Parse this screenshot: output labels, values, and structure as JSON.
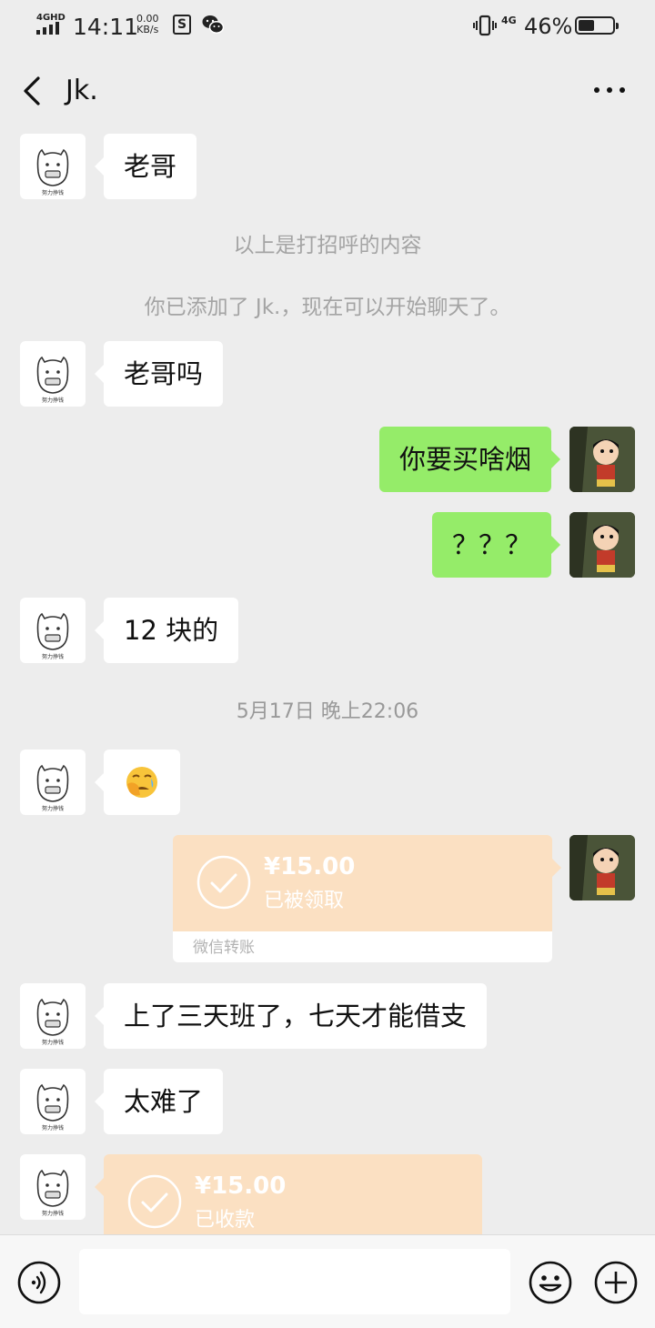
{
  "status_bar": {
    "network": "4GHD",
    "time": "14:11",
    "speed_value": "0.00",
    "speed_unit": "KB/s",
    "network2": "4G",
    "battery_percent": "46%",
    "battery_level": 0.46
  },
  "header": {
    "title": "Jk."
  },
  "messages": [
    {
      "sender": "contact",
      "type": "text",
      "text": "老哥"
    },
    {
      "type": "system",
      "text": "以上是打招呼的内容"
    },
    {
      "type": "system",
      "text": "你已添加了 Jk.，现在可以开始聊天了。"
    },
    {
      "sender": "contact",
      "type": "text",
      "text": "老哥吗"
    },
    {
      "sender": "me",
      "type": "text",
      "text": "你要买啥烟"
    },
    {
      "sender": "me",
      "type": "text",
      "text": "？？？"
    },
    {
      "sender": "contact",
      "type": "text",
      "text": "12 块的"
    },
    {
      "type": "timestamp",
      "text": "5月17日 晚上22:06"
    },
    {
      "sender": "contact",
      "type": "emoji",
      "emoji": "😭"
    },
    {
      "sender": "me",
      "type": "transfer",
      "amount": "¥15.00",
      "status": "已被领取",
      "footer": "微信转账"
    },
    {
      "sender": "contact",
      "type": "text",
      "text": "上了三天班了，七天才能借支"
    },
    {
      "sender": "contact",
      "type": "text",
      "text": "太难了"
    },
    {
      "sender": "contact",
      "type": "transfer",
      "amount": "¥15.00",
      "status": "已收款"
    }
  ],
  "avatar_labels": {
    "contact": "努力挣钱"
  },
  "input": {
    "placeholder": ""
  },
  "colors": {
    "background": "#ededed",
    "outgoing_bubble": "#95ec69",
    "incoming_bubble": "#ffffff",
    "transfer": "#fbe0c2"
  }
}
